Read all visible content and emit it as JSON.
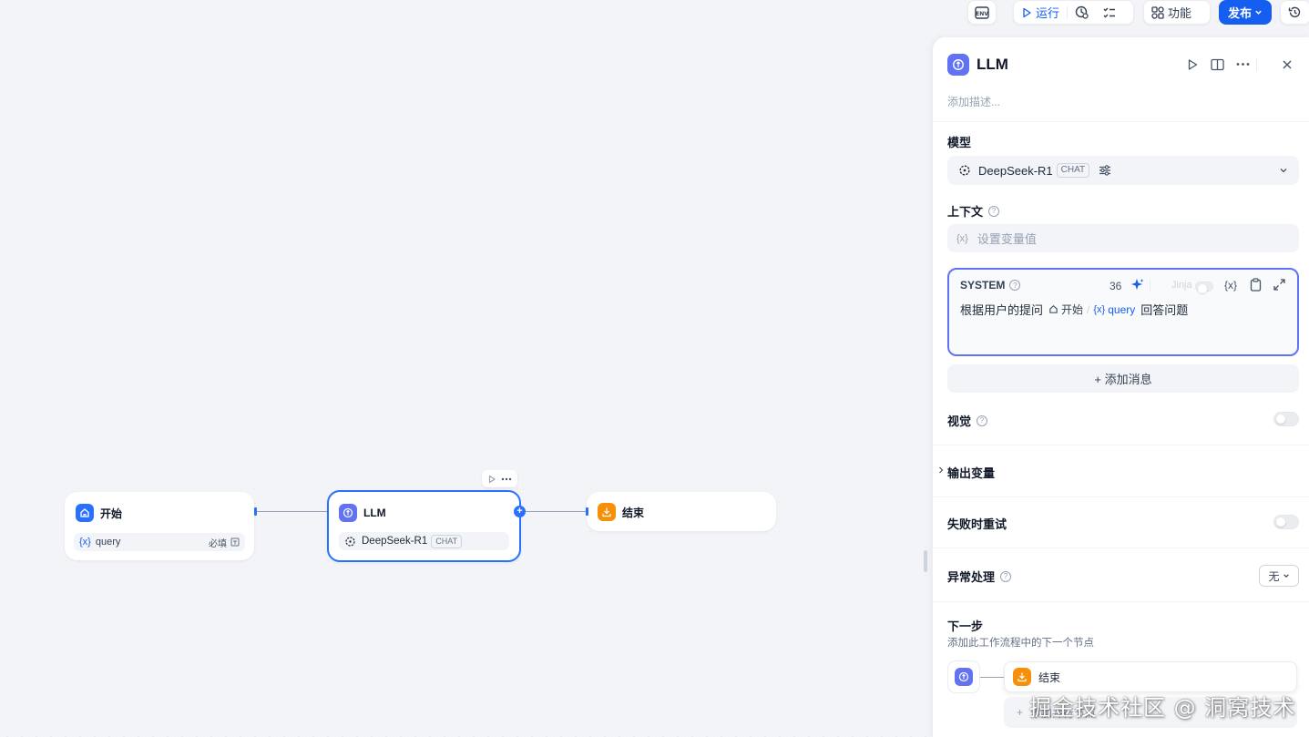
{
  "toolbar": {
    "env_label": "ENV",
    "run_label": "运行",
    "features_label": "功能",
    "publish_label": "发布"
  },
  "canvas": {
    "start_node": {
      "title": "开始",
      "var_icon": "{x}",
      "var_name": "query",
      "required": "必填"
    },
    "llm_node": {
      "title": "LLM",
      "model": "DeepSeek-R1",
      "mode_badge": "CHAT"
    },
    "end_node": {
      "title": "结束"
    }
  },
  "panel": {
    "title": "LLM",
    "description_placeholder": "添加描述...",
    "model_section": {
      "label": "模型",
      "model_name": "DeepSeek-R1",
      "mode_badge": "CHAT"
    },
    "context_section": {
      "label": "上下文",
      "var_icon": "{x}",
      "placeholder": "设置变量值"
    },
    "system_prompt": {
      "role": "SYSTEM",
      "token_count": "36",
      "jinja_label": "Jinja",
      "var_button": "{x}",
      "text_before": "根据用户的提问",
      "ref_node": "开始",
      "ref_sep": "/",
      "ref_var_icon": "{x}",
      "ref_var": "query",
      "text_after": "回答问题"
    },
    "add_message_label": "+ 添加消息",
    "vision_label": "视觉",
    "output_vars_label": "输出变量",
    "retry_label": "失败时重试",
    "error_handling": {
      "label": "异常处理",
      "value": "无"
    },
    "next_step": {
      "label": "下一步",
      "description": "添加此工作流程中的下一个节点",
      "next_node": "结束",
      "add_parallel": "添加并行节点"
    }
  },
  "watermark": "掘金技术社区 @ 洞窝技术",
  "colors": {
    "accent": "#155eef",
    "node_selected": "#2970ff",
    "llm_icon": "#6172f3",
    "end_icon": "#f79009"
  }
}
